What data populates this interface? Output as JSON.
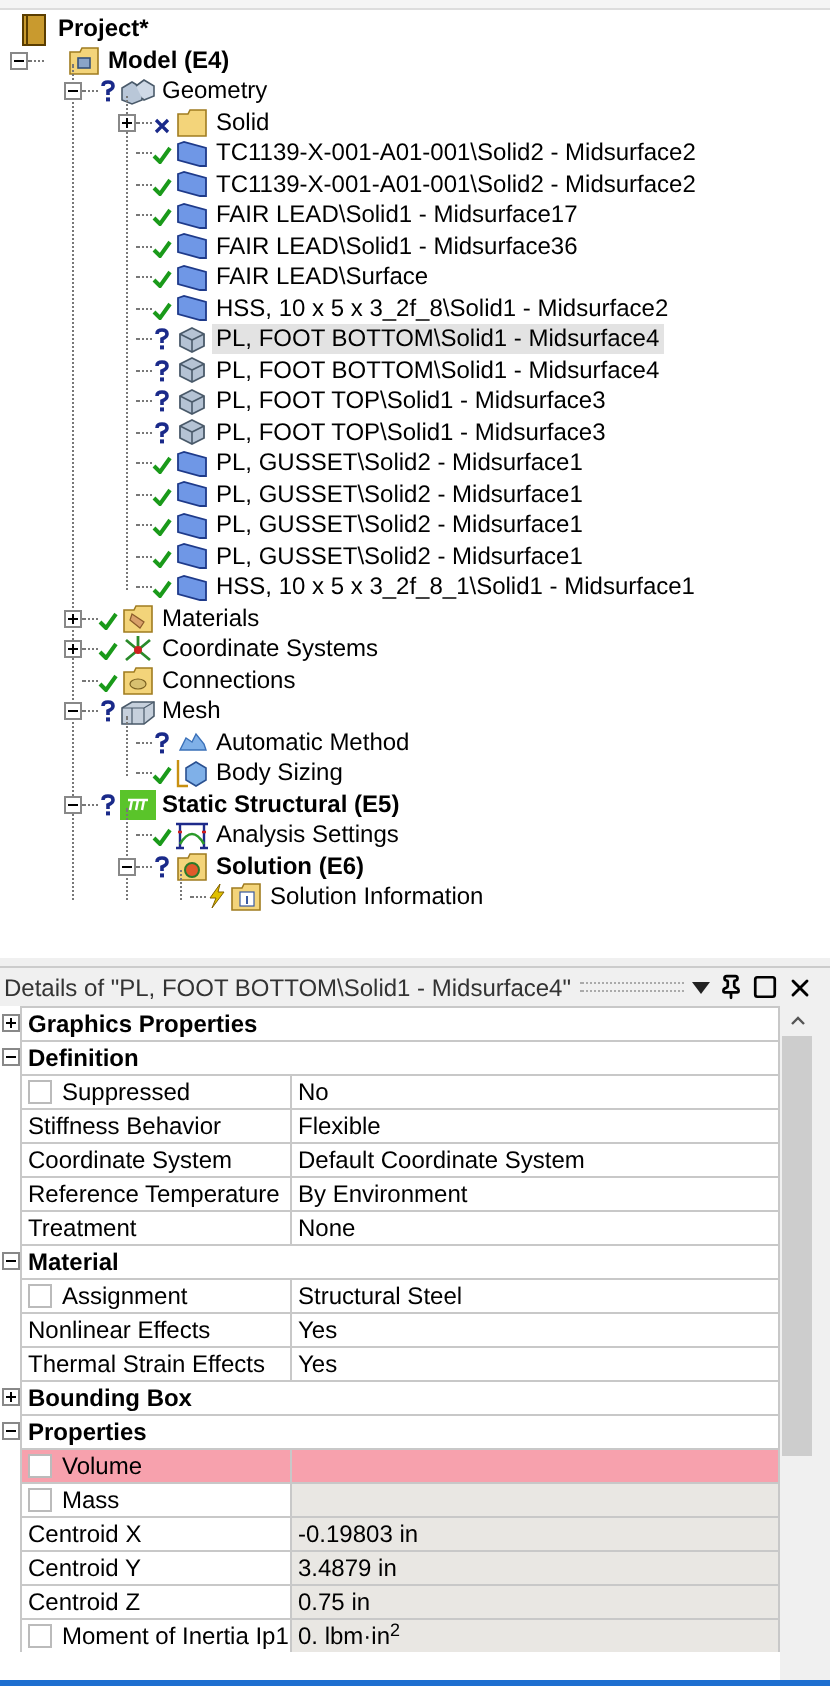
{
  "tree": {
    "label": "Project*",
    "kind": "project",
    "bold": true,
    "children": [
      {
        "label": "Model (E4)",
        "kind": "model",
        "bold": true,
        "expanded": true,
        "selected": false,
        "children": [
          {
            "label": "Geometry",
            "kind": "geometry",
            "status": {
              "kind": "question"
            },
            "expanded": true,
            "selected": false,
            "children": [
              {
                "label": "Solid",
                "kind": "folder",
                "status": {
                  "kind": "cross"
                },
                "expanded": false,
                "selected": false
              },
              {
                "label": "TC1139-X-001-A01-001\\Solid2 - Midsurface2",
                "kind": "surface",
                "status": {
                  "kind": "check"
                },
                "selected": false
              },
              {
                "label": "TC1139-X-001-A01-001\\Solid2 - Midsurface2",
                "kind": "surface",
                "status": {
                  "kind": "check"
                },
                "selected": false
              },
              {
                "label": "FAIR LEAD\\Solid1 - Midsurface17",
                "kind": "surface",
                "status": {
                  "kind": "check"
                },
                "selected": false
              },
              {
                "label": "FAIR LEAD\\Solid1 - Midsurface36",
                "kind": "surface",
                "status": {
                  "kind": "check"
                },
                "selected": false
              },
              {
                "label": "FAIR LEAD\\Surface",
                "kind": "surface",
                "status": {
                  "kind": "check"
                },
                "selected": false
              },
              {
                "label": "HSS, 10 x 5 x 3_2f_8\\Solid1 - Midsurface2",
                "kind": "surface",
                "status": {
                  "kind": "check"
                },
                "selected": false
              },
              {
                "label": "PL, FOOT BOTTOM\\Solid1 - Midsurface4",
                "kind": "solid",
                "status": {
                  "kind": "question"
                },
                "selected": true
              },
              {
                "label": "PL, FOOT BOTTOM\\Solid1 - Midsurface4",
                "kind": "solid",
                "status": {
                  "kind": "question"
                },
                "selected": false
              },
              {
                "label": "PL, FOOT TOP\\Solid1 - Midsurface3",
                "kind": "solid",
                "status": {
                  "kind": "question"
                },
                "selected": false
              },
              {
                "label": "PL, FOOT TOP\\Solid1 - Midsurface3",
                "kind": "solid",
                "status": {
                  "kind": "question"
                },
                "selected": false
              },
              {
                "label": "PL, GUSSET\\Solid2 - Midsurface1",
                "kind": "surface",
                "status": {
                  "kind": "check"
                },
                "selected": false
              },
              {
                "label": "PL, GUSSET\\Solid2 - Midsurface1",
                "kind": "surface",
                "status": {
                  "kind": "check"
                },
                "selected": false
              },
              {
                "label": "PL, GUSSET\\Solid2 - Midsurface1",
                "kind": "surface",
                "status": {
                  "kind": "check"
                },
                "selected": false
              },
              {
                "label": "PL, GUSSET\\Solid2 - Midsurface1",
                "kind": "surface",
                "status": {
                  "kind": "check"
                },
                "selected": false
              },
              {
                "label": "HSS, 10 x 5 x 3_2f_8_1\\Solid1 - Midsurface1",
                "kind": "surface",
                "status": {
                  "kind": "check"
                },
                "selected": false
              }
            ]
          },
          {
            "label": "Materials",
            "kind": "materials",
            "status": {
              "kind": "check"
            },
            "expanded": false,
            "selected": false
          },
          {
            "label": "Coordinate Systems",
            "kind": "coordinates",
            "status": {
              "kind": "check"
            },
            "expanded": false,
            "selected": false
          },
          {
            "label": "Connections",
            "kind": "connections",
            "status": {
              "kind": "check"
            },
            "selected": false
          },
          {
            "label": "Mesh",
            "kind": "mesh",
            "status": {
              "kind": "question"
            },
            "expanded": true,
            "selected": false,
            "children": [
              {
                "label": "Automatic Method",
                "kind": "method",
                "status": {
                  "kind": "question"
                },
                "selected": false
              },
              {
                "label": "Body Sizing",
                "kind": "sizing",
                "status": {
                  "kind": "check"
                },
                "selected": false
              }
            ]
          },
          {
            "label": "Static Structural (E5)",
            "kind": "structural",
            "status": {
              "kind": "question"
            },
            "bold": true,
            "expanded": true,
            "selected": false,
            "children": [
              {
                "label": "Analysis Settings",
                "kind": "analysis",
                "status": {
                  "kind": "check"
                },
                "selected": false
              },
              {
                "label": "Solution (E6)",
                "kind": "solution",
                "status": {
                  "kind": "question"
                },
                "bold": true,
                "expanded": true,
                "selected": false,
                "children": [
                  {
                    "label": "Solution Information",
                    "kind": "info",
                    "status": {
                      "kind": "lightning"
                    },
                    "selected": false
                  }
                ]
              }
            ]
          }
        ]
      }
    ]
  },
  "details": {
    "title": "Details of \"PL, FOOT BOTTOM\\Solid1 - Midsurface4\"",
    "sections": [
      {
        "title": "Graphics Properties",
        "expanded": false
      },
      {
        "title": "Definition",
        "expanded": true,
        "rows": [
          {
            "label": "Suppressed",
            "value": "No",
            "checked": false
          },
          {
            "label": "Stiffness Behavior",
            "value": "Flexible"
          },
          {
            "label": "Coordinate System",
            "value": "Default Coordinate System"
          },
          {
            "label": "Reference Temperature",
            "value": "By Environment"
          },
          {
            "label": "Treatment",
            "value": "None"
          }
        ]
      },
      {
        "title": "Material",
        "expanded": true,
        "rows": [
          {
            "label": "Assignment",
            "value": "Structural Steel",
            "checked": false
          },
          {
            "label": "Nonlinear Effects",
            "value": "Yes"
          },
          {
            "label": "Thermal Strain Effects",
            "value": "Yes"
          }
        ]
      },
      {
        "title": "Bounding Box",
        "expanded": false
      },
      {
        "title": "Properties",
        "expanded": true,
        "rows": [
          {
            "label": "Volume",
            "checked": false,
            "highlighted": true,
            "readonly": true
          },
          {
            "label": "Mass",
            "checked": false,
            "readonly": true
          },
          {
            "label": "Centroid X",
            "value": "-0.19803 in",
            "readonly": true
          },
          {
            "label": "Centroid Y",
            "value": "3.4879 in",
            "readonly": true
          },
          {
            "label": "Centroid Z",
            "value": "0.75 in",
            "readonly": true
          },
          {
            "label": "Moment of Inertia Ip1",
            "value": "0. lbm·in$^{2}$",
            "checked": false,
            "readonly": true
          }
        ]
      }
    ]
  }
}
